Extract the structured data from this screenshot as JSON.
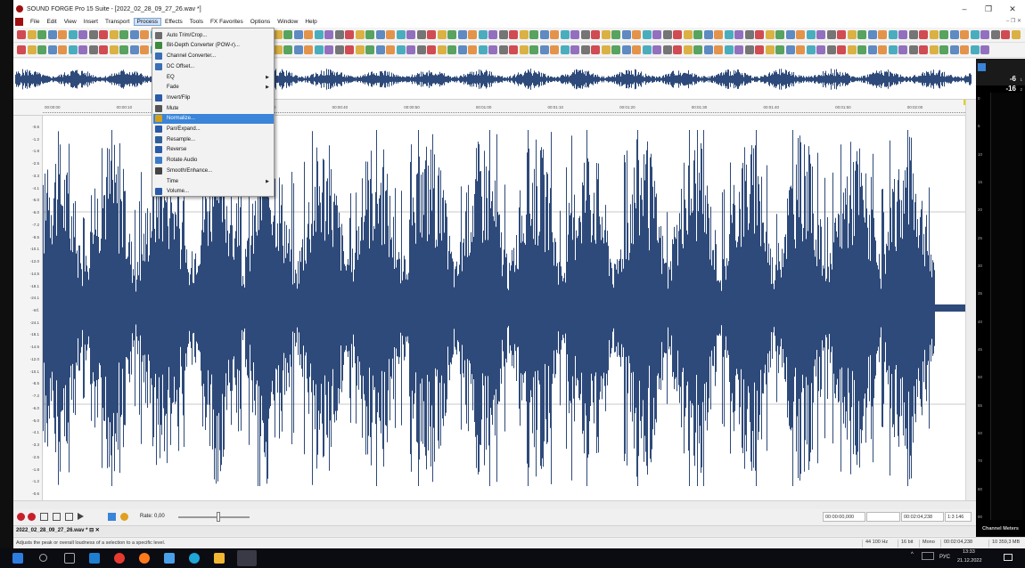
{
  "window": {
    "title": "SOUND FORGE Pro 15 Suite - [2022_02_28_09_27_26.wav *]",
    "controls": [
      "–",
      "❐",
      "✕"
    ]
  },
  "menubar": {
    "items": [
      "File",
      "Edit",
      "View",
      "Insert",
      "Transport",
      "Process",
      "Effects",
      "Tools",
      "FX Favorites",
      "Options",
      "Window",
      "Help"
    ],
    "mdi_controls": "– ❐ ✕"
  },
  "process_menu": {
    "items": [
      {
        "label": "Auto Trim/Crop...",
        "icon": "scissors-icon",
        "color": "#6b6b6b",
        "submenu": false
      },
      {
        "label": "Bit-Depth Converter (POW-r)...",
        "icon": "bit-depth-icon",
        "color": "#3c8a3c",
        "submenu": false
      },
      {
        "label": "Channel Converter...",
        "icon": "channel-icon",
        "color": "#3a6fb5",
        "submenu": false
      },
      {
        "label": "DC Offset...",
        "icon": "dc-offset-icon",
        "color": "#3a6fb5",
        "submenu": false
      },
      {
        "label": "EQ",
        "icon": "",
        "color": "",
        "submenu": true
      },
      {
        "label": "Fade",
        "icon": "",
        "color": "",
        "submenu": true
      },
      {
        "label": "Invert/Flip",
        "icon": "invert-icon",
        "color": "#2a5aa8",
        "submenu": false
      },
      {
        "label": "Mute",
        "icon": "mute-icon",
        "color": "#555555",
        "submenu": false
      },
      {
        "label": "Normalize...",
        "icon": "normalize-icon",
        "color": "#d4a017",
        "submenu": false
      },
      {
        "label": "Pan/Expand...",
        "icon": "pan-icon",
        "color": "#2a5aa8",
        "submenu": false
      },
      {
        "label": "Resample...",
        "icon": "resample-icon",
        "color": "#2f5f9a",
        "submenu": false
      },
      {
        "label": "Reverse",
        "icon": "reverse-icon",
        "color": "#2a5aa8",
        "submenu": false
      },
      {
        "label": "Rotate Audio",
        "icon": "rotate-icon",
        "color": "#3a7cc8",
        "submenu": false
      },
      {
        "label": "Smooth/Enhance...",
        "icon": "smooth-icon",
        "color": "#444444",
        "submenu": false
      },
      {
        "label": "Time",
        "icon": "",
        "color": "",
        "submenu": true
      },
      {
        "label": "Volume...",
        "icon": "volume-icon",
        "color": "#2a5aa8",
        "submenu": false
      }
    ],
    "highlighted_index": 8
  },
  "ruler": {
    "ticks": [
      "00:00:00",
      "00:00:10",
      "00:00:20",
      "00:00:30",
      "00:00:40",
      "00:00:50",
      "00:01:00",
      "00:01:10",
      "00:01:20",
      "00:01:30",
      "00:01:40",
      "00:01:50",
      "00:02:00"
    ]
  },
  "db_scale": [
    "-0.6",
    "-1.2",
    "-1.8",
    "-2.5",
    "-3.3",
    "-4.1",
    "-5.0",
    "-6.0",
    "-7.2",
    "-8.5",
    "-10.1",
    "-12.0",
    "-14.5",
    "-18.1",
    "-24.1",
    "-Inf.",
    "-24.1",
    "-18.1",
    "-14.5",
    "-12.0",
    "-10.1",
    "-8.5",
    "-7.2",
    "-6.0",
    "-5.0",
    "-4.1",
    "-3.3",
    "-2.5",
    "-1.8",
    "-1.2",
    "-0.6"
  ],
  "transport": {
    "rate_label": "Rate: 0,00",
    "selection_start": "00:00:00,000",
    "selection_length": "",
    "length": "00:02:04,238",
    "zoom": "1:3 146"
  },
  "doc_tab": {
    "label": "2022_02_28_09_27_26.wav *",
    "controls": "⊟ ✕"
  },
  "statusbar": {
    "message": "Adjusts the peak or overall loudness of a selection to a specific level.",
    "sample_rate": "44 100 Hz",
    "bit_depth": "16 bit",
    "channels": "Mono",
    "duration": "00:02:04,238",
    "free_space": "10 359,3 MB"
  },
  "meters": {
    "label": "Channel Meters",
    "peak_top": "-6",
    "peak_sub": "1",
    "peak2_top": "-16",
    "peak2_sub": "2",
    "scale": [
      "0",
      "5",
      "10",
      "15",
      "20",
      "25",
      "30",
      "35",
      "40",
      "45",
      "50",
      "55",
      "60",
      "70",
      "80",
      "90"
    ]
  },
  "taskbar": {
    "lang": "РУС",
    "time": "13:33",
    "date": "21.12.2022"
  },
  "colors": {
    "waveform": "#2e4a7a",
    "highlight": "#3a84d9",
    "meters_bg": "#000000"
  }
}
